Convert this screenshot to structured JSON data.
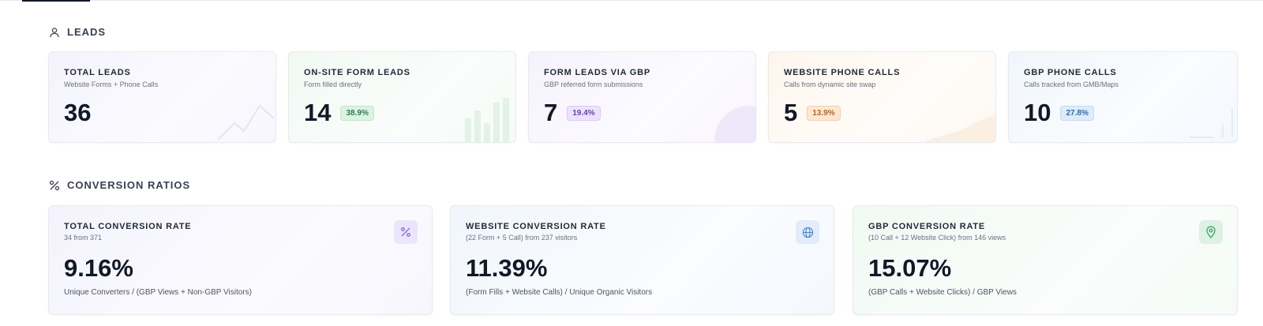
{
  "leads_section": {
    "title": "LEADS",
    "icon": "user-icon",
    "cards": [
      {
        "title": "TOTAL LEADS",
        "subtitle": "Website Forms + Phone Calls",
        "value": "36",
        "badge": ""
      },
      {
        "title": "ON-SITE FORM LEADS",
        "subtitle": "Form filled directly",
        "value": "14",
        "badge": "38.9%"
      },
      {
        "title": "FORM LEADS VIA GBP",
        "subtitle": "GBP referred form submissions",
        "value": "7",
        "badge": "19.4%"
      },
      {
        "title": "WEBSITE PHONE CALLS",
        "subtitle": "Calls from dynamic site swap",
        "value": "5",
        "badge": "13.9%"
      },
      {
        "title": "GBP PHONE CALLS",
        "subtitle": "Calls tracked from GMB/Maps",
        "value": "10",
        "badge": "27.8%"
      }
    ]
  },
  "conversion_section": {
    "title": "CONVERSION RATIOS",
    "icon": "percent-icon",
    "cards": [
      {
        "title": "TOTAL CONVERSION RATE",
        "subtitle": "34 from 371",
        "value": "9.16%",
        "formula": "Unique Converters / (GBP Views + Non-GBP Visitors)",
        "icon": "percent-icon"
      },
      {
        "title": "WEBSITE CONVERSION RATE",
        "subtitle": "(22 Form + 5 Call) from 237 visitors",
        "value": "11.39%",
        "formula": "(Form Fills + Website Calls) / Unique Organic Visitors",
        "icon": "globe-icon"
      },
      {
        "title": "GBP CONVERSION RATE",
        "subtitle": "(10 Call + 12 Website Click) from 146 views",
        "value": "15.07%",
        "formula": "(GBP Calls + Website Clicks) / GBP Views",
        "icon": "map-pin-icon"
      }
    ]
  }
}
